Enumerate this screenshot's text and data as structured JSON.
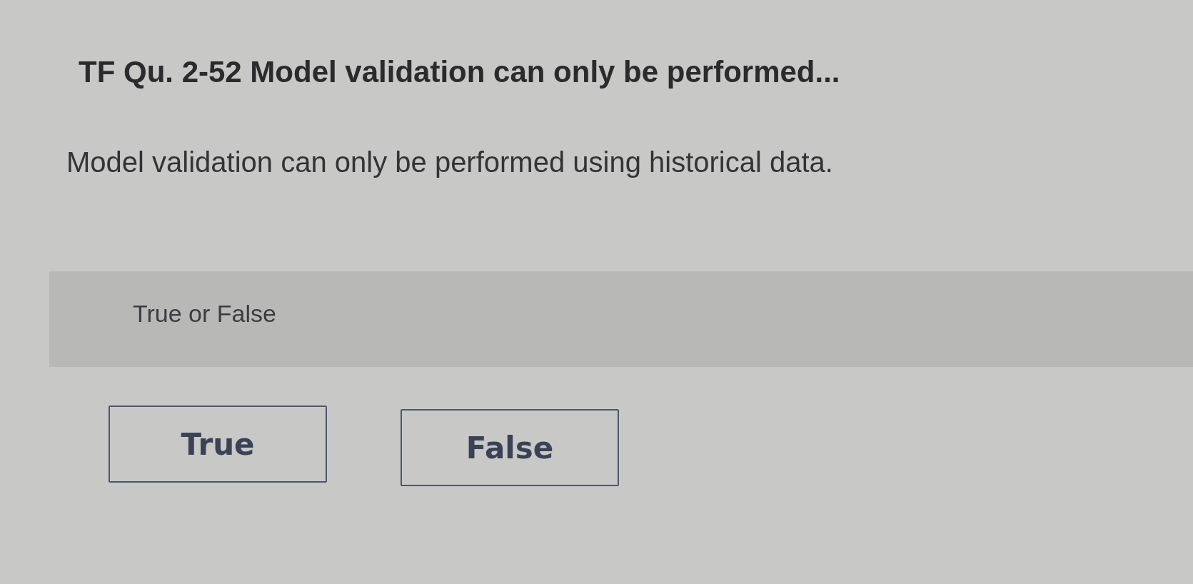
{
  "question": {
    "title": "TF Qu. 2-52 Model validation can only be performed...",
    "prompt": "Model validation can only be performed using historical data."
  },
  "answer_panel": {
    "label": "True or False"
  },
  "options": [
    {
      "label": "True",
      "selected": false
    },
    {
      "label": "False",
      "selected": false
    }
  ]
}
